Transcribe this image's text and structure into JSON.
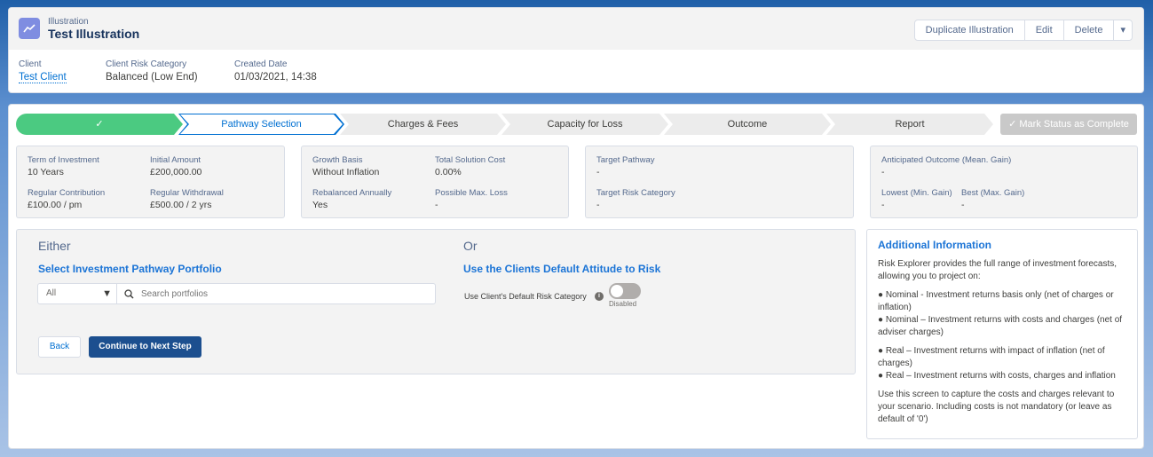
{
  "header": {
    "object_label": "Illustration",
    "title": "Test Illustration",
    "buttons": [
      "Duplicate Illustration",
      "Edit",
      "Delete"
    ],
    "fields": [
      {
        "label": "Client",
        "value": "Test Client"
      },
      {
        "label": "Client Risk Category",
        "value": "Balanced (Low End)"
      },
      {
        "label": "Created Date",
        "value": "01/03/2021, 14:38"
      }
    ]
  },
  "path": {
    "steps": [
      "✓",
      "Pathway Selection",
      "Charges & Fees",
      "Capacity for Loss",
      "Outcome",
      "Report"
    ],
    "complete_button": "Mark Status as Complete"
  },
  "summary": [
    [
      {
        "k": "Term of Investment",
        "v": "10 Years"
      },
      {
        "k": "Initial Amount",
        "v": "£200,000.00"
      },
      {
        "k": "Regular Contribution",
        "v": "£100.00 / pm"
      },
      {
        "k": "Regular Withdrawal",
        "v": "£500.00 / 2 yrs"
      }
    ],
    [
      {
        "k": "Growth Basis",
        "v": "Without Inflation"
      },
      {
        "k": "Total Solution Cost",
        "v": "0.00%"
      },
      {
        "k": "Rebalanced Annually",
        "v": "Yes"
      },
      {
        "k": "Possible Max. Loss",
        "v": "-"
      }
    ],
    [
      {
        "k": "Target Pathway",
        "v": "-"
      },
      {
        "k": "Target Risk Category",
        "v": "-"
      }
    ],
    [
      {
        "k": "Anticipated Outcome (Mean. Gain)",
        "v": "-"
      },
      {
        "k": "Lowest (Min. Gain)",
        "v": "-"
      },
      {
        "k": "Best (Max. Gain)",
        "v": "-"
      }
    ]
  ],
  "left": {
    "either": "Either",
    "either_title": "Select Investment Pathway Portfolio",
    "filter": "All",
    "search_placeholder": "Search portfolios",
    "or": "Or",
    "or_title": "Use the Clients Default Attitude to Risk",
    "toggle_label": "Use Client's Default Risk Category",
    "toggle_state": "Disabled",
    "back": "Back",
    "next": "Continue to Next Step"
  },
  "info": {
    "title": "Additional Information",
    "p1": "Risk Explorer provides the full range of investment forecasts, allowing you to project on:",
    "b1": "● Nominal - Investment returns basis only (net of charges or inflation)",
    "b2": "● Nominal – Investment returns with costs and charges (net of adviser charges)",
    "b3": "● Real – Investment returns with impact of inflation (net of charges)",
    "b4": "● Real – Investment returns with costs, charges and inflation",
    "p2": "Use this screen to capture the costs and charges relevant to your scenario. Including costs is not mandatory (or leave as default of '0')"
  }
}
